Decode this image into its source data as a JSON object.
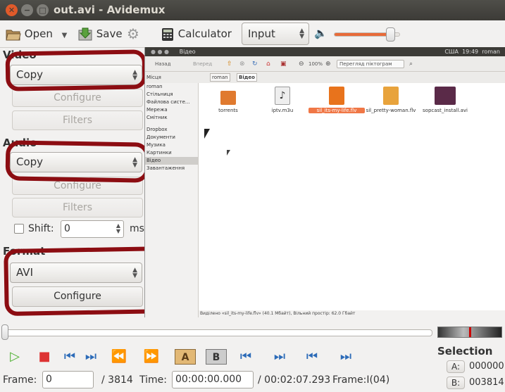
{
  "window": {
    "title": "out.avi - Avidemux"
  },
  "toolbar": {
    "open_label": "Open",
    "save_label": "Save",
    "calculator_label": "Calculator",
    "input_label": "Input",
    "volume_level": 0.85
  },
  "video": {
    "heading": "Video",
    "codec": "Copy",
    "configure_label": "Configure",
    "filters_label": "Filters"
  },
  "audio": {
    "heading": "Audio",
    "codec": "Copy",
    "configure_label": "Configure",
    "filters_label": "Filters",
    "shift_label": "Shift:",
    "shift_value": "0",
    "shift_unit": "ms"
  },
  "format": {
    "heading": "Format",
    "container": "AVI",
    "configure_label": "Configure"
  },
  "preview": {
    "window_title": "Відео",
    "indicators": [
      "США",
      "19:49",
      "roman"
    ],
    "nav_back": "Назад",
    "nav_forward": "Вперед",
    "crumb_home": "roman",
    "crumb_current": "Відео",
    "zoom": "100%",
    "view_mode": "Перегляд піктограм",
    "places_label": "Місця",
    "sidebar": [
      "roman",
      "Стільниця",
      "Файлова систе...",
      "Мережа",
      "Смітник",
      "Dropbox",
      "Документи",
      "Музика",
      "Картинки",
      "Відео",
      "Завантаження"
    ],
    "files": [
      {
        "name": "torrents",
        "color": "#e07a2f"
      },
      {
        "name": "iptv.m3u",
        "color": "#444444"
      },
      {
        "name": "sil_its-my-life.flv",
        "color": "#e8731c"
      },
      {
        "name": "sil_pretty-woman.flv",
        "color": "#e8a33c"
      },
      {
        "name": "sopcast_install.avi",
        "color": "#5a2a48"
      }
    ],
    "status": "Виділено «sil_its-my-life.flv» (40.1 Мбайт), Вільний простір: 62.0 Гбайт"
  },
  "playback": {
    "frame_label": "Frame:",
    "frame_value": "0",
    "frame_total": "/ 3814",
    "time_label": "Time:",
    "time_value": "00:00:00.000",
    "duration": "/ 00:02:07.293",
    "frame_type": "Frame:I(04)"
  },
  "selection": {
    "heading": "Selection",
    "a_label": "A:",
    "a_value": "000000",
    "b_label": "B:",
    "b_value": "003814"
  },
  "colors": {
    "annotation": "#8c0d12",
    "selected_file": "#f07746"
  }
}
